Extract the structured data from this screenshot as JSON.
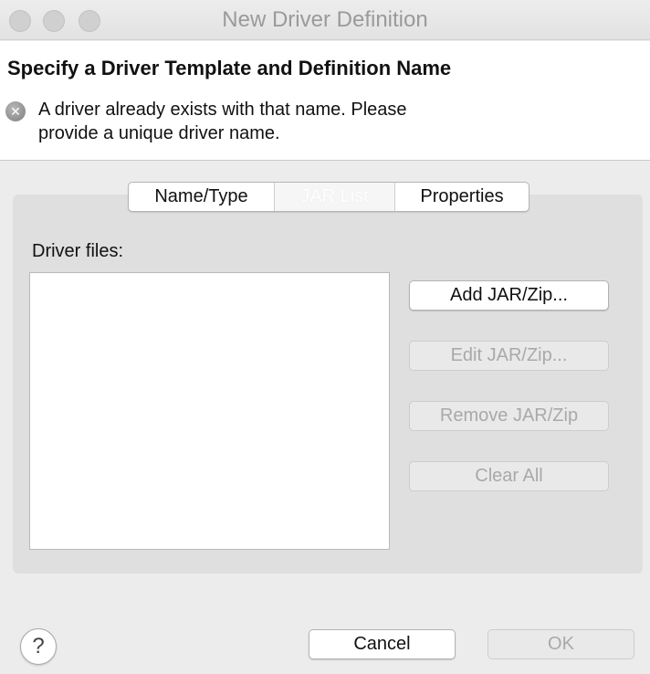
{
  "window": {
    "title": "New Driver Definition"
  },
  "banner": {
    "heading": "Specify a Driver Template and Definition Name",
    "error_icon": "error-x-icon",
    "error_line1": "A driver already exists with that name. Please",
    "error_line2": "provide a unique driver name."
  },
  "tabs": [
    {
      "label": "Name/Type",
      "selected": false
    },
    {
      "label": "JAR List",
      "selected": true
    },
    {
      "label": "Properties",
      "selected": false
    }
  ],
  "jar_list": {
    "files_label": "Driver files:",
    "files": [],
    "buttons": {
      "add": "Add JAR/Zip...",
      "edit": "Edit JAR/Zip...",
      "remove": "Remove JAR/Zip",
      "clear": "Clear All"
    }
  },
  "footer": {
    "help_icon": "help-icon",
    "help_glyph": "?",
    "cancel": "Cancel",
    "ok": "OK"
  },
  "colors": {
    "window_bg": "#ececec",
    "banner_bg": "#ffffff",
    "disabled_text": "#a9a9a9"
  }
}
